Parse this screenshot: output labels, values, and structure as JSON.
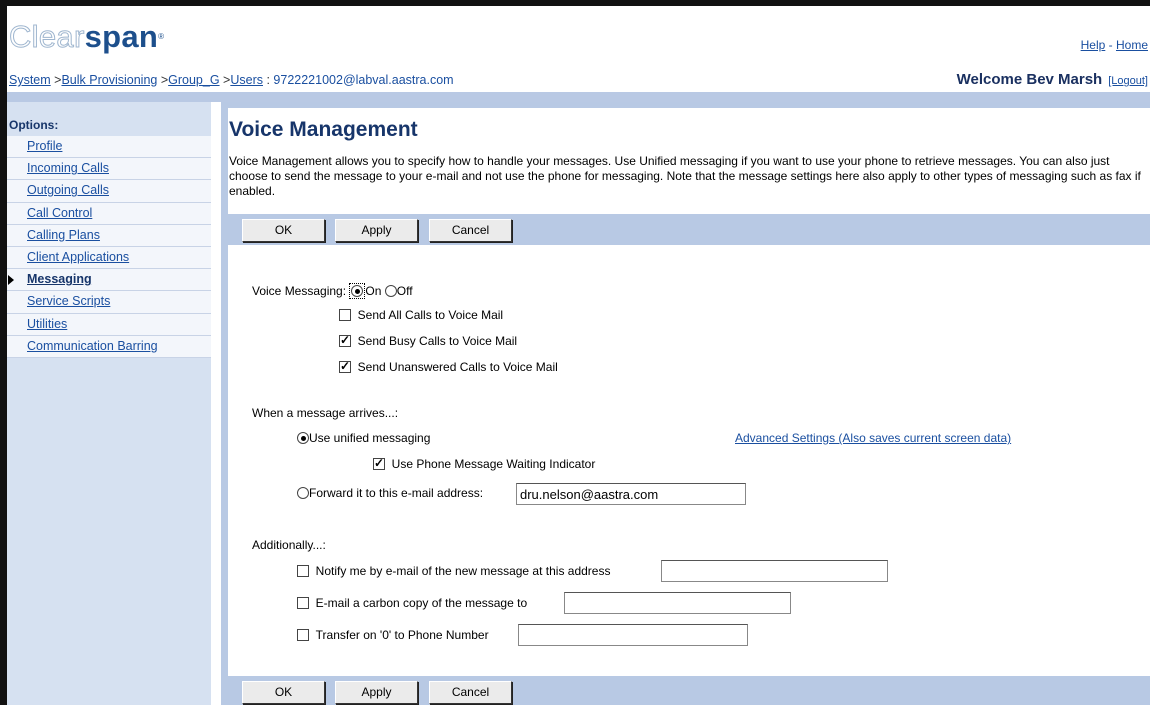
{
  "header": {
    "logo_part1": "Clear",
    "logo_part2": "span",
    "help": "Help",
    "home": "Home",
    "toplink_sep": " - ",
    "welcome": "Welcome Bev Marsh",
    "logout": "[Logout]"
  },
  "breadcrumb": {
    "system": "System",
    "bulk": "Bulk Provisioning",
    "group": "Group_G",
    "users": "Users",
    "user": "9722221002@labval.aastra.com"
  },
  "sidebar": {
    "heading": "Options:",
    "items": [
      {
        "label": "Profile"
      },
      {
        "label": "Incoming Calls"
      },
      {
        "label": "Outgoing Calls"
      },
      {
        "label": "Call Control"
      },
      {
        "label": "Calling Plans"
      },
      {
        "label": "Client Applications"
      },
      {
        "label": "Messaging",
        "active": true
      },
      {
        "label": "Service Scripts"
      },
      {
        "label": "Utilities"
      },
      {
        "label": "Communication Barring"
      }
    ]
  },
  "main": {
    "title": "Voice Management",
    "description": "Voice Management allows you to specify how to handle your messages. Use Unified messaging if you want to use your phone to retrieve messages. You can also just choose to send the message to your e-mail and not use the phone for messaging. Note that the message settings here also apply to other types of messaging such as fax if enabled."
  },
  "buttons": {
    "ok": "OK",
    "apply": "Apply",
    "cancel": "Cancel"
  },
  "form": {
    "voice_messaging_label": "Voice Messaging:",
    "on": "On",
    "off": "Off",
    "voice_messaging_value": "On",
    "send_all": {
      "label": "Send All Calls to Voice Mail",
      "checked": false
    },
    "send_busy": {
      "label": "Send Busy Calls to Voice Mail",
      "checked": true
    },
    "send_unanswered": {
      "label": "Send Unanswered Calls to Voice Mail",
      "checked": true
    },
    "when_arrives": "When a message arrives...:",
    "use_unified": {
      "label": "Use unified messaging",
      "selected": true
    },
    "advanced_link": "Advanced Settings (Also saves current screen data)",
    "use_mwi": {
      "label": "Use Phone Message Waiting Indicator",
      "checked": true
    },
    "forward": {
      "label": "Forward it to this e-mail address:",
      "selected": false,
      "value": "dru.nelson@aastra.com"
    },
    "additionally": "Additionally...:",
    "notify": {
      "label": "Notify me by e-mail of the new message at this address",
      "checked": false,
      "value": ""
    },
    "carbon": {
      "label": "E-mail a carbon copy of the message to",
      "checked": false,
      "value": ""
    },
    "transfer": {
      "label": "Transfer on '0' to Phone Number",
      "checked": false,
      "value": ""
    }
  }
}
